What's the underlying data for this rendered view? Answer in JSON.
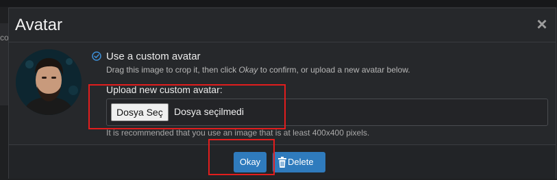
{
  "backdrop": {
    "left_text": "co"
  },
  "dialog": {
    "title": "Avatar",
    "close_glyph": "×",
    "option": {
      "title": "Use a custom avatar",
      "description_before": "Drag this image to crop it, then click ",
      "description_emph": "Okay",
      "description_after": " to confirm, or upload a new avatar below."
    },
    "upload": {
      "label": "Upload new custom avatar:",
      "choose_button": "Dosya Seç",
      "no_file_text": "Dosya seçilmedi",
      "hint": "It is recommended that you use an image that is at least 400x400 pixels."
    },
    "footer": {
      "okay_label": "Okay",
      "delete_label": "Delete"
    }
  },
  "colors": {
    "accent": "#2f7bbd",
    "annotation": "#e31d1d",
    "background": "#26282b"
  },
  "icons": [
    "close-icon",
    "radio-checked-icon",
    "trash-icon"
  ]
}
